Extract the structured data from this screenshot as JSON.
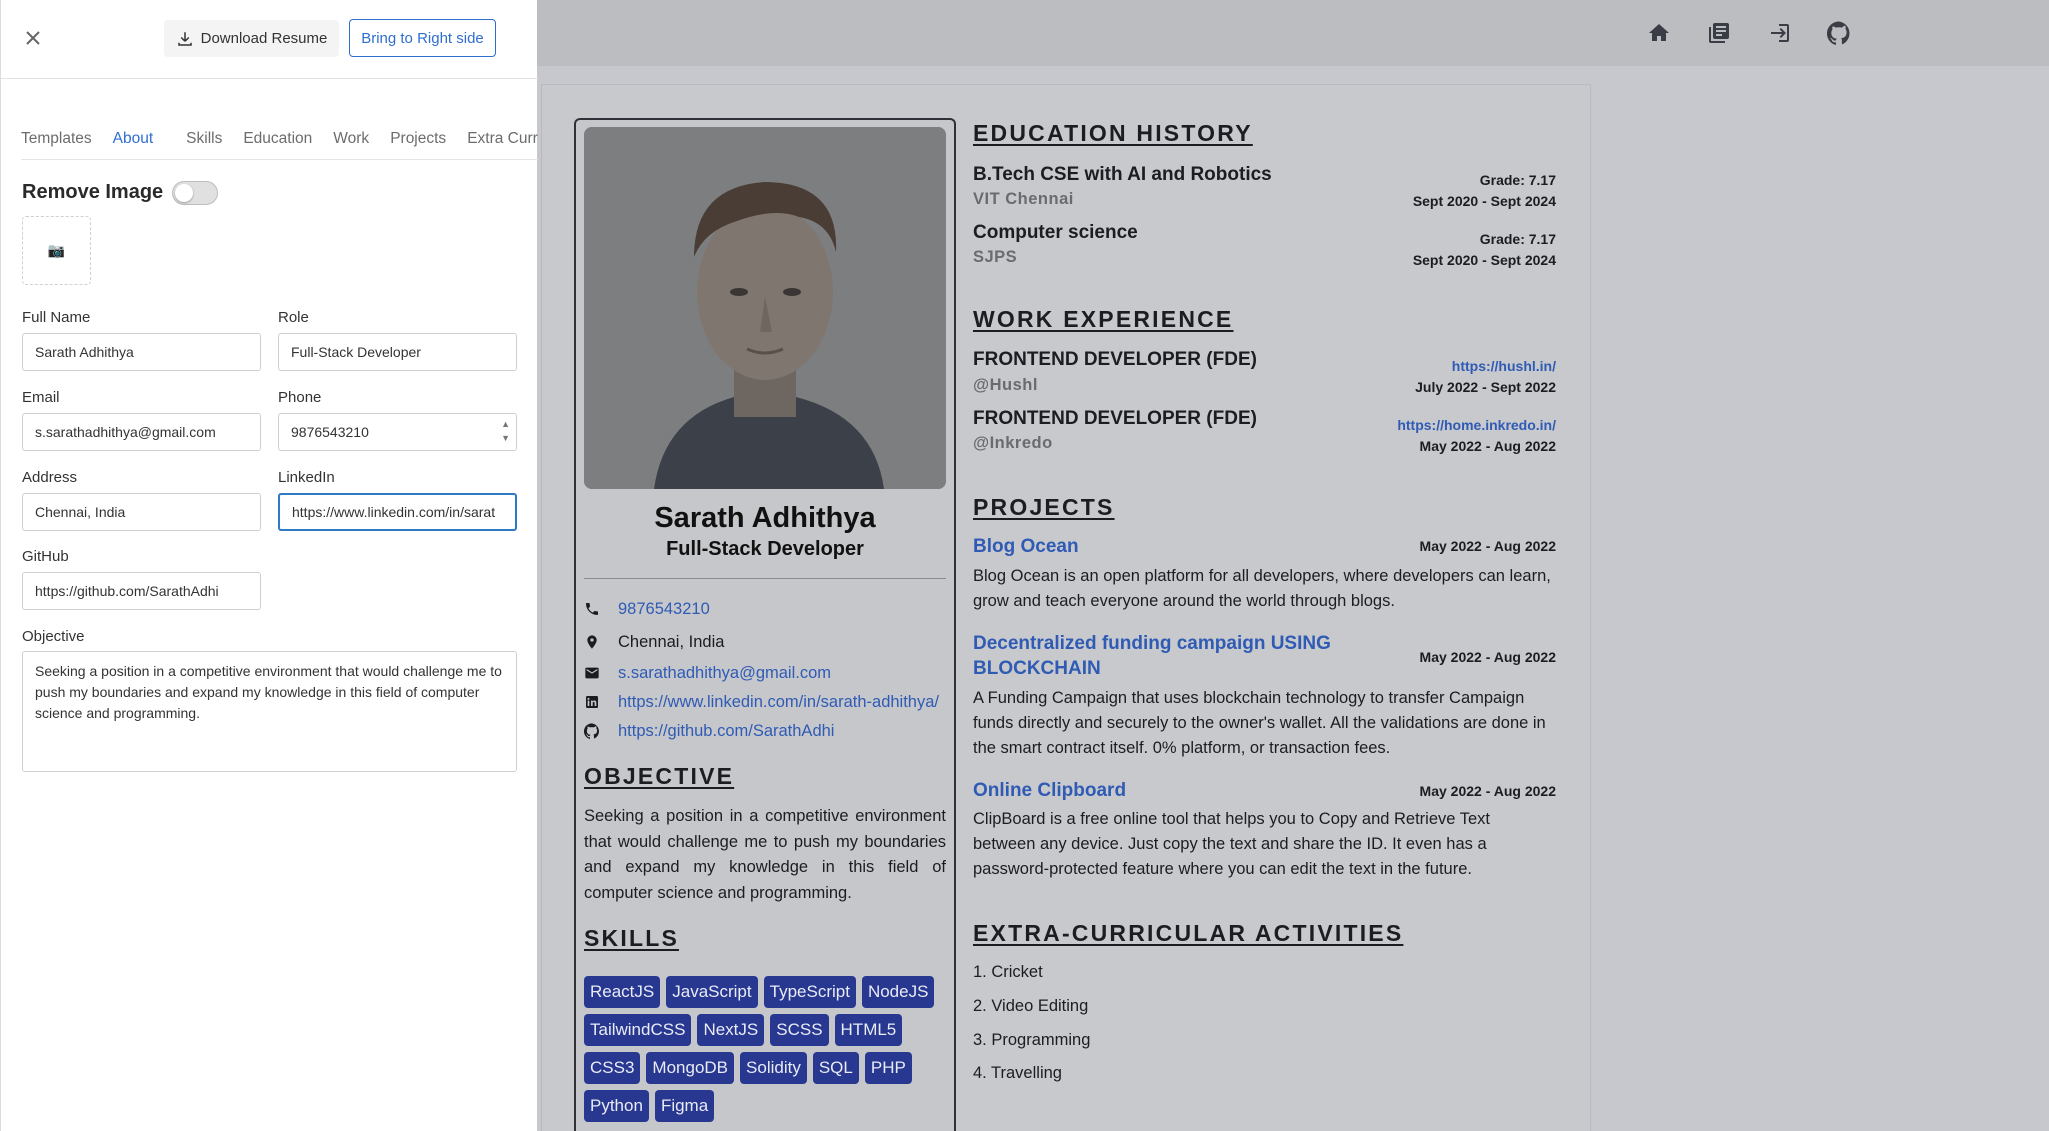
{
  "drawer": {
    "download_label": "Download Resume",
    "bring_label": "Bring to Right side",
    "tabs": [
      "Templates",
      "About",
      "Skills",
      "Education",
      "Work",
      "Projects",
      "Extra Curricular"
    ],
    "active_tab": "About",
    "remove_image_label": "Remove Image",
    "image_placeholder": "📷",
    "fields": {
      "full_name_label": "Full Name",
      "full_name": "Sarath Adhithya",
      "role_label": "Role",
      "role": "Full-Stack Developer",
      "email_label": "Email",
      "email": "s.sarathadhithya@gmail.com",
      "phone_label": "Phone",
      "phone": "9876543210",
      "address_label": "Address",
      "address": "Chennai, India",
      "linkedin_label": "LinkedIn",
      "linkedin": "https://www.linkedin.com/in/sarat",
      "github_label": "GitHub",
      "github": "https://github.com/SarathAdhi",
      "objective_label": "Objective",
      "objective": "Seeking a position in a competitive environment that would challenge me to push my boundaries and expand my knowledge in this field of computer science and programming."
    }
  },
  "nav_icons": [
    "home-icon",
    "docs-icon",
    "login-icon",
    "github-icon"
  ],
  "resume": {
    "name": "Sarath Adhithya",
    "role": "Full-Stack Developer",
    "contacts": {
      "phone": "9876543210",
      "address": "Chennai, India",
      "email": "s.sarathadhithya@gmail.com",
      "linkedin": "https://www.linkedin.com/in/sarath-adhithya/",
      "github": "https://github.com/SarathAdhi"
    },
    "objective_heading": "OBJECTIVE",
    "objective": "Seeking a position in a competitive environment that would challenge me to push my boundaries and expand my knowledge in this field of computer science and programming.",
    "skills_heading": "SKILLS",
    "skills": [
      "ReactJS",
      "JavaScript",
      "TypeScript",
      "NodeJS",
      "TailwindCSS",
      "NextJS",
      "SCSS",
      "HTML5",
      "CSS3",
      "MongoDB",
      "Solidity",
      "SQL",
      "PHP",
      "Python",
      "Figma"
    ],
    "education_heading": "EDUCATION HISTORY",
    "education": [
      {
        "degree": "B.Tech CSE with AI and Robotics",
        "school": "VIT Chennai",
        "grade": "Grade: 7.17",
        "dates": "Sept 2020 - Sept 2024"
      },
      {
        "degree": "Computer science",
        "school": "SJPS",
        "grade": "Grade: 7.17",
        "dates": "Sept 2020 - Sept 2024"
      }
    ],
    "work_heading": "WORK EXPERIENCE",
    "work": [
      {
        "title": "FRONTEND DEVELOPER (FDE)",
        "company": "@Hushl",
        "url": "https://hushl.in/",
        "dates": "July 2022 - Sept 2022"
      },
      {
        "title": "FRONTEND DEVELOPER (FDE)",
        "company": "@Inkredo",
        "url": "https://home.inkredo.in/",
        "dates": "May 2022 - Aug 2022"
      }
    ],
    "projects_heading": "PROJECTS",
    "projects": [
      {
        "title": "Blog Ocean",
        "dates": "May 2022 - Aug 2022",
        "desc": "Blog Ocean is an open platform for all developers, where developers can learn, grow and teach everyone around the world through blogs."
      },
      {
        "title_line1": "Decentralized funding campaign USING",
        "title_line2": "BLOCKCHAIN",
        "dates": "May 2022 - Aug 2022",
        "desc": "A Funding Campaign that uses blockchain technology to transfer Campaign funds directly and securely to the owner's wallet. All the validations are done in the smart contract itself. 0% platform, or transaction fees."
      },
      {
        "title": "Online Clipboard",
        "dates": "May 2022 - Aug 2022",
        "desc": "ClipBoard is a free online tool that helps you to Copy and Retrieve Text between any device. Just copy the text and share the ID. It even has a password-protected feature where you can edit the text in the future."
      }
    ],
    "extra_heading": "EXTRA-CURRICULAR ACTIVITIES",
    "activities": [
      "1. Cricket",
      "2. Video Editing",
      "3. Programming",
      "4. Travelling"
    ]
  }
}
